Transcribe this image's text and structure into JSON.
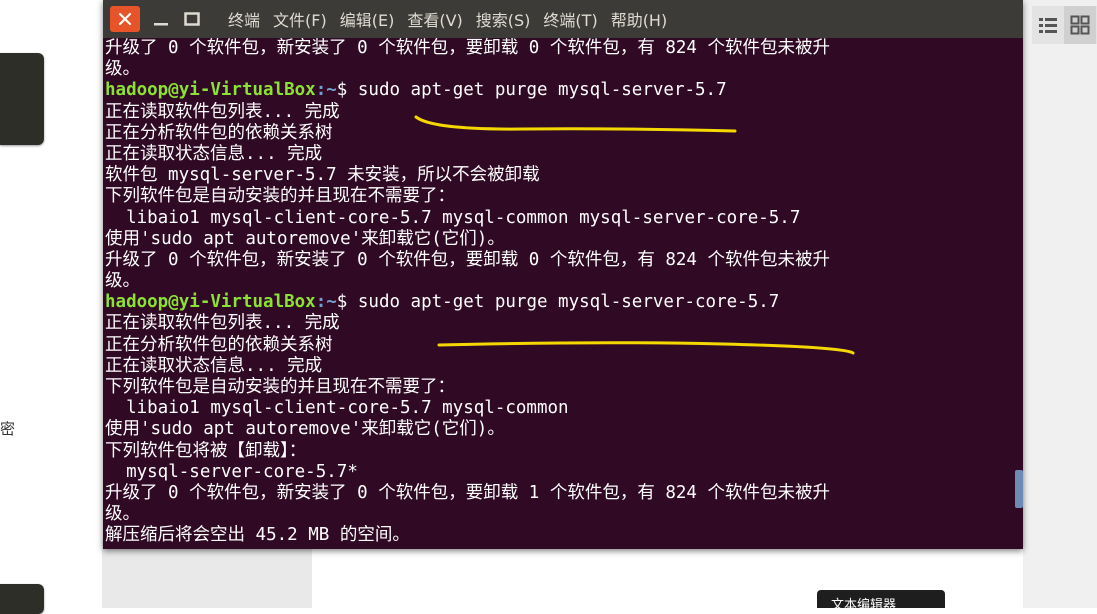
{
  "terminal": {
    "menu": [
      "终端",
      "文件(F)",
      "编辑(E)",
      "查看(V)",
      "搜索(S)",
      "终端(T)",
      "帮助(H)"
    ],
    "lines": [
      {
        "kind": "text",
        "text": "升级了 0 个软件包，新安装了 0 个软件包，要卸载 0 个软件包，有 824 个软件包未被升"
      },
      {
        "kind": "text",
        "text": "级。"
      },
      {
        "kind": "prompt",
        "user": "hadoop@yi-VirtualBox",
        "path": ":~",
        "cmd": "$ sudo apt-get purge mysql-server-5.7"
      },
      {
        "kind": "text",
        "text": "正在读取软件包列表... 完成"
      },
      {
        "kind": "text",
        "text": "正在分析软件包的依赖关系树"
      },
      {
        "kind": "text",
        "text": "正在读取状态信息... 完成"
      },
      {
        "kind": "text",
        "text": "软件包 mysql-server-5.7 未安装，所以不会被卸载"
      },
      {
        "kind": "text",
        "text": "下列软件包是自动安装的并且现在不需要了："
      },
      {
        "kind": "text",
        "text": "  libaio1 mysql-client-core-5.7 mysql-common mysql-server-core-5.7"
      },
      {
        "kind": "text",
        "text": "使用'sudo apt autoremove'来卸载它(它们)。"
      },
      {
        "kind": "text",
        "text": "升级了 0 个软件包，新安装了 0 个软件包，要卸载 0 个软件包，有 824 个软件包未被升"
      },
      {
        "kind": "text",
        "text": "级。"
      },
      {
        "kind": "prompt",
        "user": "hadoop@yi-VirtualBox",
        "path": ":~",
        "cmd": "$ sudo apt-get purge mysql-server-core-5.7"
      },
      {
        "kind": "text",
        "text": "正在读取软件包列表... 完成"
      },
      {
        "kind": "text",
        "text": "正在分析软件包的依赖关系树"
      },
      {
        "kind": "text",
        "text": "正在读取状态信息... 完成"
      },
      {
        "kind": "text",
        "text": "下列软件包是自动安装的并且现在不需要了："
      },
      {
        "kind": "text",
        "text": "  libaio1 mysql-client-core-5.7 mysql-common"
      },
      {
        "kind": "text",
        "text": "使用'sudo apt autoremove'来卸载它(它们)。"
      },
      {
        "kind": "text",
        "text": "下列软件包将被【卸载】："
      },
      {
        "kind": "text",
        "text": "  mysql-server-core-5.7*"
      },
      {
        "kind": "text",
        "text": "升级了 0 个软件包，新安装了 0 个软件包，要卸载 1 个软件包，有 824 个软件包未被升"
      },
      {
        "kind": "text",
        "text": "级。"
      },
      {
        "kind": "text",
        "text": "解压缩后将会空出 45.2 MB 的空间。"
      }
    ]
  },
  "background": {
    "side_char": "密",
    "tooltip": "文本编辑器"
  },
  "colors": {
    "terminal_bg": "#300a24",
    "prompt_user": "#8ae234",
    "prompt_path": "#729fcf",
    "annotation": "#f5d800"
  },
  "icons": {
    "close": "close-icon",
    "minimize": "minimize-icon",
    "maximize": "maximize-icon",
    "list_view": "list-view-icon",
    "grid_view": "grid-view-icon"
  }
}
